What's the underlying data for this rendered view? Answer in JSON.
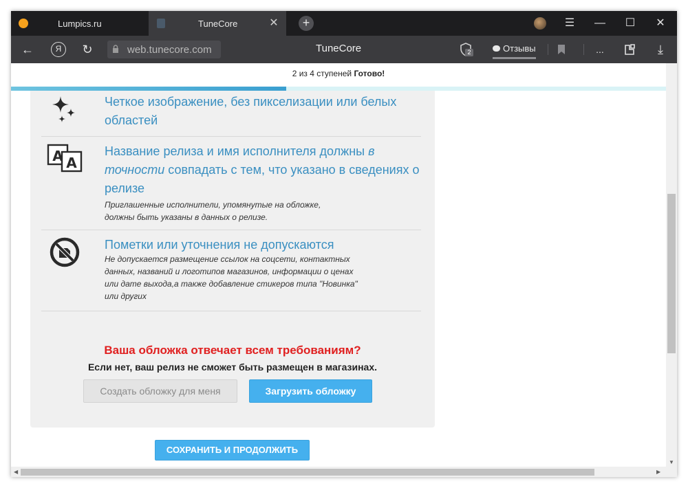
{
  "browser": {
    "tabs": [
      {
        "label": "Lumpics.ru",
        "active": false
      },
      {
        "label": "TuneCore",
        "active": true
      }
    ],
    "close_glyph": "✕",
    "new_tab_glyph": "+",
    "menu_glyph": "☰",
    "minimize_glyph": "—",
    "maximize_glyph": "☐",
    "window_close_glyph": "✕",
    "back_glyph": "←",
    "yandex_glyph": "Я",
    "reload_glyph": "↻",
    "url": "web.tunecore.com",
    "page_title": "TuneCore",
    "shield_count": "2",
    "reviews_label": "Отзывы",
    "more_glyph": "...",
    "download_glyph": "⤓"
  },
  "progress": {
    "text": "2 из 4 ступеней",
    "status": "Готово!",
    "fraction": 0.42
  },
  "requirements": [
    {
      "icon": "sparkle-icon",
      "title": "Четкое изображение, без пикселизации или белых областей",
      "note": ""
    },
    {
      "icon": "text-match-icon",
      "title_parts": [
        "Название релиза и имя исполнителя должны ",
        "в точности",
        " совпадать с тем, что указано в сведениях о релизе"
      ],
      "note": "Приглашенные исполнители, упомянутые на обложке, должны быть указаны в данных о релизе."
    },
    {
      "icon": "no-sticker-icon",
      "title": "Пометки или уточнения не допускаются",
      "note": "Не допускается размещение ссылок на соцсети, контактных данных, названий и логотипов магазинов, информации о ценах или дате выхода,а также добавление стикеров типа \"Новинка\" или других"
    }
  ],
  "confirm": {
    "question": "Ваша обложка отвечает всем требованиям?",
    "warning": "Если нет, ваш релиз не сможет быть размещен в магазинах.",
    "create_cover_label": "Создать обложку для меня",
    "upload_cover_label": "Загрузить обложку"
  },
  "save_continue_label": "СОХРАНИТЬ И ПРОДОЛЖИТЬ",
  "colors": {
    "accent_blue": "#45b0ee",
    "title_blue": "#3a8fc1",
    "question_red": "#e02020",
    "panel_bg": "#f0f0f0"
  }
}
